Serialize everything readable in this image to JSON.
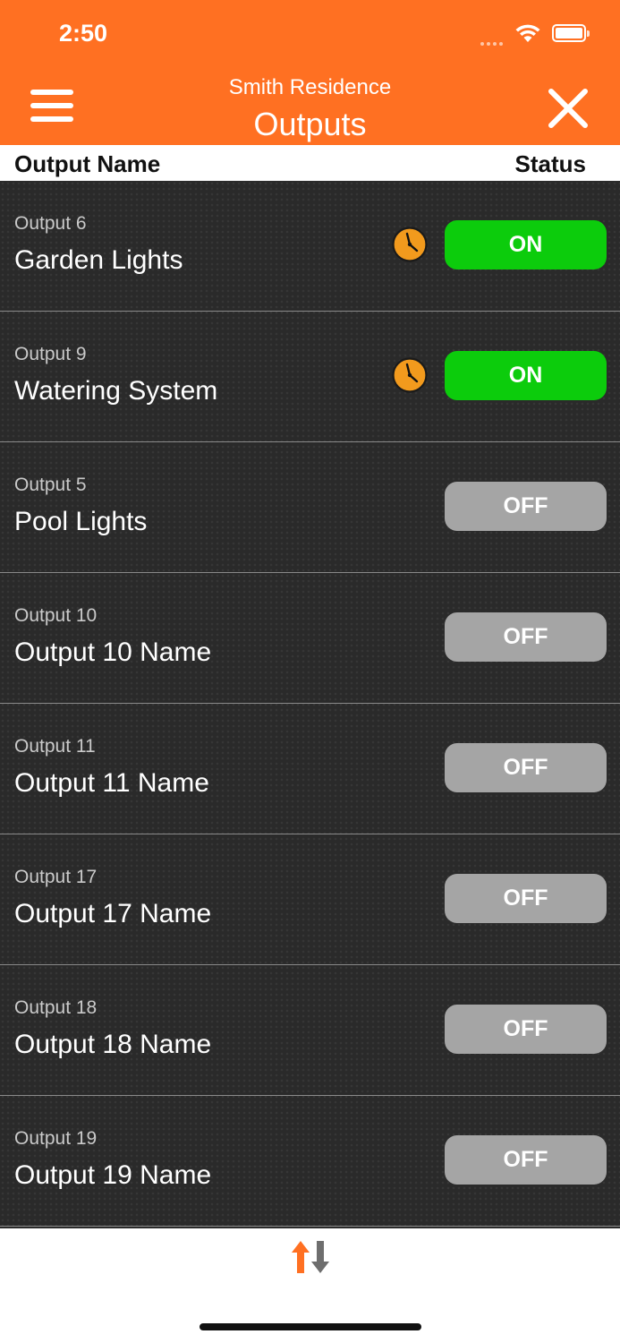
{
  "status_bar": {
    "time": "2:50"
  },
  "header": {
    "subtitle": "Smith Residence",
    "title": "Outputs",
    "accent_color": "#ff7022",
    "menu_icon": "hamburger-menu-icon",
    "close_icon": "close-icon"
  },
  "columns": {
    "name": "Output Name",
    "status": "Status"
  },
  "outputs": [
    {
      "number": "Output 6",
      "name": "Garden Lights",
      "scheduled": true,
      "status": "ON"
    },
    {
      "number": "Output 9",
      "name": "Watering System",
      "scheduled": true,
      "status": "ON"
    },
    {
      "number": "Output 5",
      "name": "Pool Lights",
      "scheduled": false,
      "status": "OFF"
    },
    {
      "number": "Output 10",
      "name": "Output 10 Name",
      "scheduled": false,
      "status": "OFF"
    },
    {
      "number": "Output 11",
      "name": "Output 11 Name",
      "scheduled": false,
      "status": "OFF"
    },
    {
      "number": "Output 17",
      "name": "Output 17 Name",
      "scheduled": false,
      "status": "OFF"
    },
    {
      "number": "Output 18",
      "name": "Output 18 Name",
      "scheduled": false,
      "status": "OFF"
    },
    {
      "number": "Output 19",
      "name": "Output 19 Name",
      "scheduled": false,
      "status": "OFF"
    }
  ],
  "colors": {
    "on": "#0ccc0c",
    "off": "#a5a5a5",
    "schedule": "#f29a1d"
  },
  "footer": {
    "sort_icon": "sort-up-down-icon"
  }
}
